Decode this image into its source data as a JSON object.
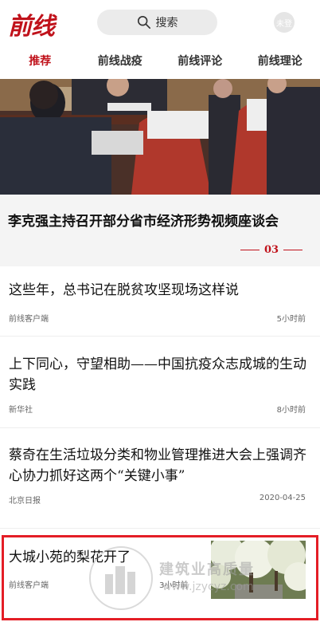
{
  "header": {
    "logo": "前线",
    "search_label": "搜索",
    "user_label": "未登"
  },
  "tabs": [
    {
      "label": "推荐",
      "active": true
    },
    {
      "label": "前线战疫",
      "active": false
    },
    {
      "label": "前线评论",
      "active": false
    },
    {
      "label": "前线理论",
      "active": false
    }
  ],
  "hero": {
    "title": "李克强主持召开部分省市经济形势视频座谈会",
    "page_indicator": "03"
  },
  "articles": [
    {
      "title": "这些年，总书记在脱贫攻坚现场这样说",
      "source": "前线客户端",
      "time": "5小时前"
    },
    {
      "title": "上下同心，守望相助——中国抗疫众志成城的生动实践",
      "source": "新华社",
      "time": "8小时前"
    },
    {
      "title": "蔡奇在生活垃圾分类和物业管理推进大会上强调齐心协力抓好这两个“关键小事”",
      "source": "北京日报",
      "time": "2020-04-25"
    },
    {
      "title": "大城小苑的梨花开了",
      "source": "前线客户端",
      "time": "3小时前"
    }
  ],
  "watermark": {
    "name": "建筑业高质量",
    "url": "www.jzycyz.com"
  },
  "colors": {
    "brand_red": "#c0121b",
    "highlight_border": "#e41e26"
  }
}
